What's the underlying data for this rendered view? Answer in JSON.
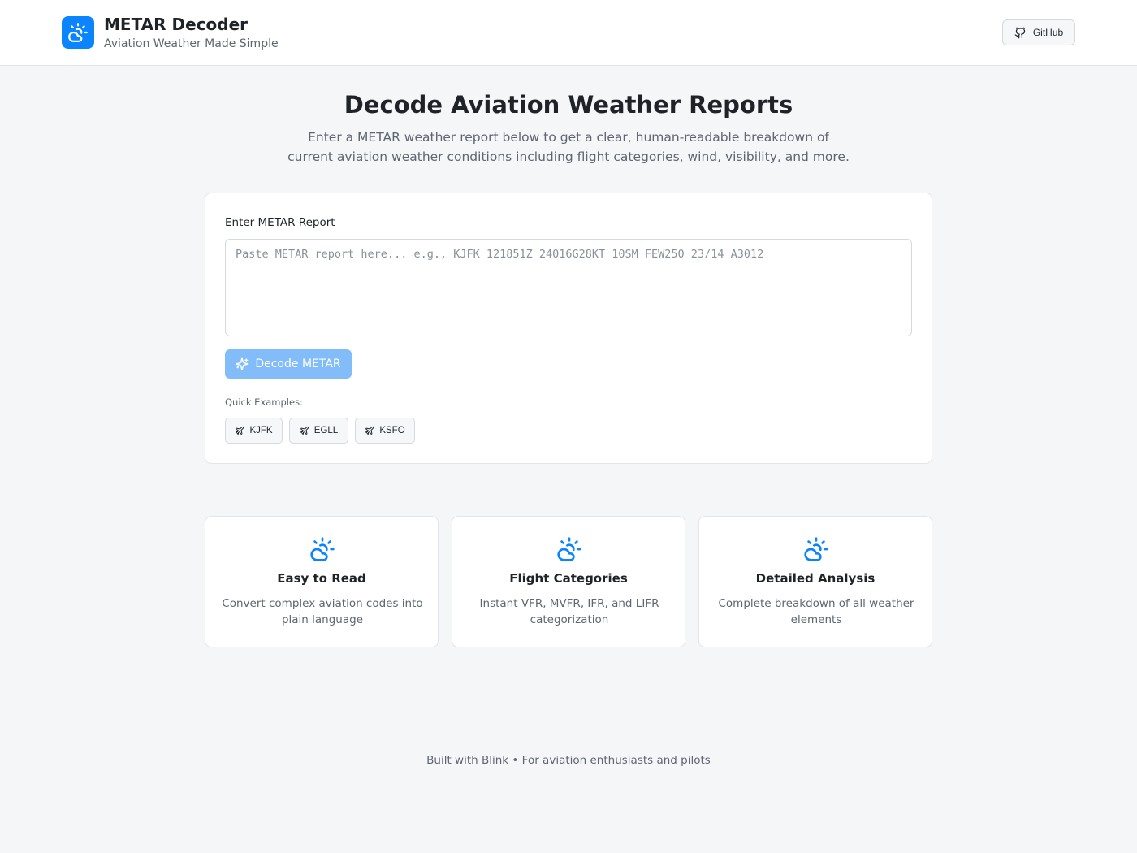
{
  "header": {
    "title": "METAR Decoder",
    "subtitle": "Aviation Weather Made Simple",
    "logo_icon": "sun-cloud-icon",
    "github_label": "GitHub",
    "github_icon": "github-icon"
  },
  "hero": {
    "title": "Decode Aviation Weather Reports",
    "description": "Enter a METAR weather report below to get a clear, human-readable breakdown of current aviation weather conditions including flight categories, wind, visibility, and more."
  },
  "input_card": {
    "label": "Enter METAR Report",
    "value": "",
    "placeholder": "Paste METAR report here... e.g., KJFK 121851Z 24016G28KT 10SM FEW250 23/14 A3012",
    "decode_label": "Decode METAR",
    "decode_icon": "sparkles-icon",
    "decode_disabled": true,
    "quick_examples_label": "Quick Examples:",
    "examples": [
      {
        "label": "KJFK",
        "icon": "plane-icon"
      },
      {
        "label": "EGLL",
        "icon": "plane-icon"
      },
      {
        "label": "KSFO",
        "icon": "plane-icon"
      }
    ]
  },
  "features": [
    {
      "title": "Easy to Read",
      "description": "Convert complex aviation codes into plain language",
      "icon": "sun-cloud-icon"
    },
    {
      "title": "Flight Categories",
      "description": "Instant VFR, MVFR, IFR, and LIFR categorization",
      "icon": "sun-cloud-icon"
    },
    {
      "title": "Detailed Analysis",
      "description": "Complete breakdown of all weather elements",
      "icon": "sun-cloud-icon"
    }
  ],
  "footer": {
    "text": "Built with Blink • For aviation enthusiasts and pilots"
  },
  "colors": {
    "accent": "#0a84ff",
    "accent_disabled": "#82bdfa",
    "page_bg": "#f5f6f8",
    "text_primary": "#1f2328",
    "text_secondary": "#5f6670",
    "border": "#e3e5e8"
  }
}
